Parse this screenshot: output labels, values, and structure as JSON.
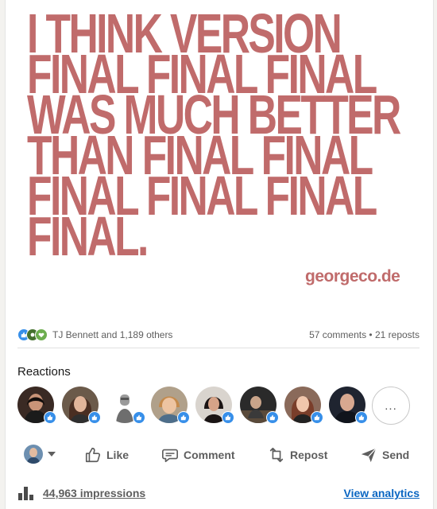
{
  "poster": {
    "lines": [
      "I THINK VERSION",
      "FINAL FINAL FINAL",
      "WAS MUCH BETTER",
      "THAN FINAL FINAL",
      "FINAL FINAL FINAL",
      "FINAL."
    ],
    "brand": "georgeco.de",
    "color": "#c06b6b"
  },
  "social": {
    "reactor_text": "TJ Bennett and 1,189 others",
    "counts_text": "57 comments • 21 reposts",
    "reaction_icons": [
      "like-icon",
      "celebrate-icon",
      "support-icon"
    ]
  },
  "reactions": {
    "title": "Reactions",
    "more_label": "..."
  },
  "actions": {
    "like": "Like",
    "comment": "Comment",
    "repost": "Repost",
    "send": "Send"
  },
  "footer": {
    "impressions": "44,963 impressions",
    "analytics": "View analytics"
  },
  "colors": {
    "accent": "#0a66c2",
    "like_blue": "#378fe9",
    "muted_text": "#5e5e5e"
  }
}
